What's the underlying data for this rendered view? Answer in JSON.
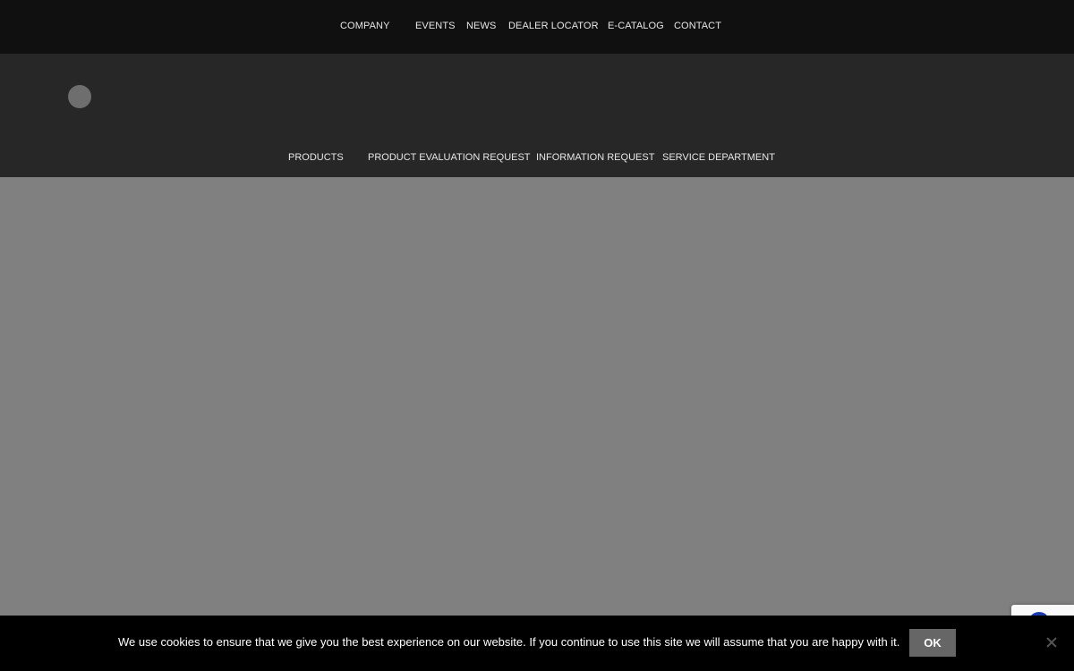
{
  "top_nav": {
    "items": [
      {
        "label": "COMPANY"
      },
      {
        "label": "EVENTS"
      },
      {
        "label": "NEWS"
      },
      {
        "label": "DEALER LOCATOR"
      },
      {
        "label": "E-CATALOG"
      },
      {
        "label": "CONTACT"
      }
    ]
  },
  "main_nav": {
    "items": [
      {
        "label": "PRODUCTS"
      },
      {
        "label": "PRODUCT EVALUATION REQUEST"
      },
      {
        "label": "INFORMATION REQUEST"
      },
      {
        "label": "SERVICE DEPARTMENT"
      }
    ]
  },
  "cookie_notice": {
    "message": "We use cookies to ensure that we give you the best experience on our website. If you continue to use this site we will assume that you are happy with it.",
    "ok_label": "OK",
    "close_icon": "close-icon"
  },
  "colors": {
    "top_bar": "#101010",
    "header": "#272727",
    "hero": "#808080",
    "cookie_bar": "#000000",
    "ok_button": "#666666"
  }
}
